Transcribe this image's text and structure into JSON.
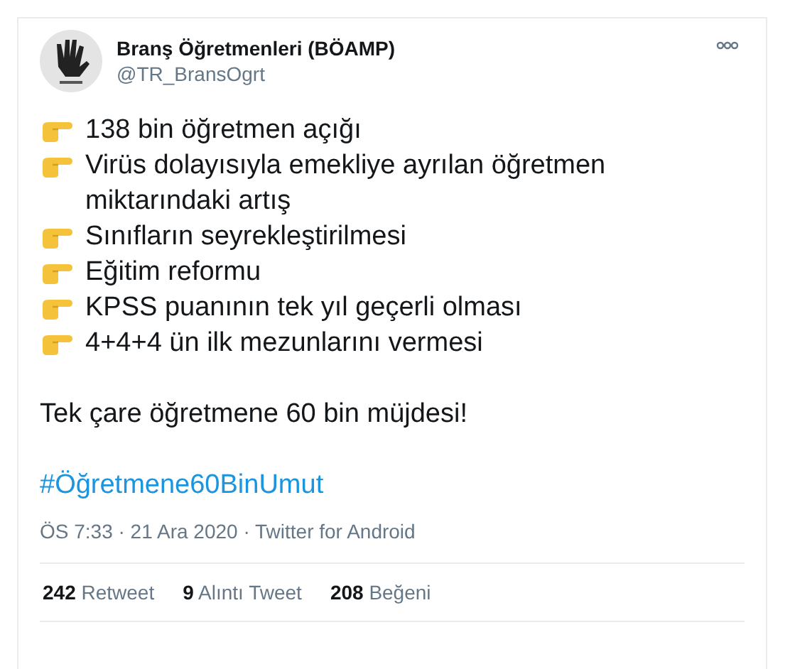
{
  "tweet": {
    "author_name": "Branş Öğretmenleri (BÖAMP)",
    "handle": "@TR_BransOgrt",
    "items": [
      "138 bin öğretmen açığı",
      "Virüs dolayısıyla emekliye ayrılan öğretmen miktarındaki artış",
      "Sınıfların seyrekleştirilmesi",
      "Eğitim reformu",
      "KPSS puanının tek yıl geçerli olması",
      "4+4+4 ün ilk mezunlarını vermesi"
    ],
    "closing": "Tek çare öğretmene 60 bin müjdesi!",
    "hashtag": "#Öğretmene60BinUmut",
    "meta": "ÖS 7:33 · 21 Ara 2020 · Twitter for Android",
    "stats": [
      {
        "count": "242",
        "label": "Retweet"
      },
      {
        "count": "9",
        "label": "Alıntı Tweet"
      },
      {
        "count": "208",
        "label": "Beğeni"
      }
    ]
  }
}
